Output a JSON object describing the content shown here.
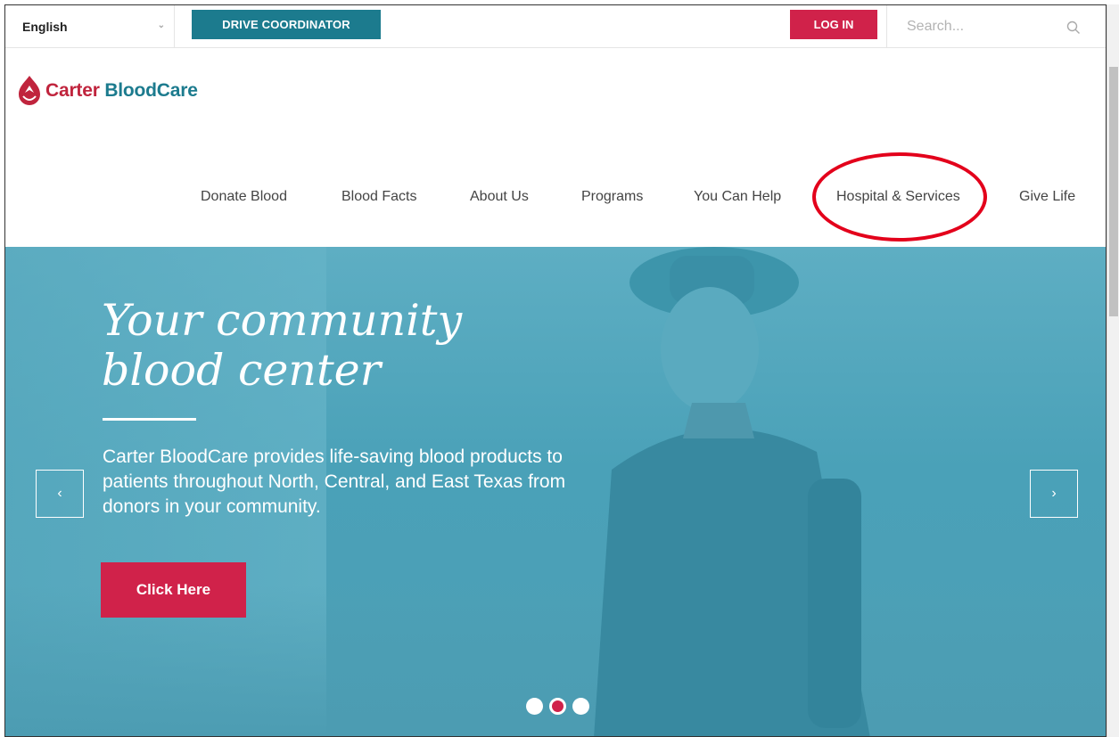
{
  "topbar": {
    "language": "English",
    "drive_coordinator_label": "DRIVE COORDINATOR",
    "login_label": "LOG IN",
    "search_placeholder": "Search..."
  },
  "logo": {
    "carter": "Carter",
    "bloodcare": "BloodCare"
  },
  "nav": {
    "items": [
      {
        "label": "Donate Blood"
      },
      {
        "label": "Blood Facts"
      },
      {
        "label": "About Us"
      },
      {
        "label": "Programs"
      },
      {
        "label": "You Can Help"
      },
      {
        "label": "Hospital & Services"
      },
      {
        "label": "Give Life"
      }
    ]
  },
  "hero": {
    "title_line1": "Your community",
    "title_line2": "blood center",
    "description": "Carter BloodCare provides life-saving blood products to patients throughout North, Central, and East Texas from donors in your community.",
    "cta_label": "Click Here",
    "prev_arrow": "‹",
    "next_arrow": "›",
    "slides_total": 3,
    "active_slide": 2
  },
  "colors": {
    "brand_teal": "#1c7b8e",
    "brand_red": "#d0224a",
    "highlight_circle": "#e3001b"
  }
}
